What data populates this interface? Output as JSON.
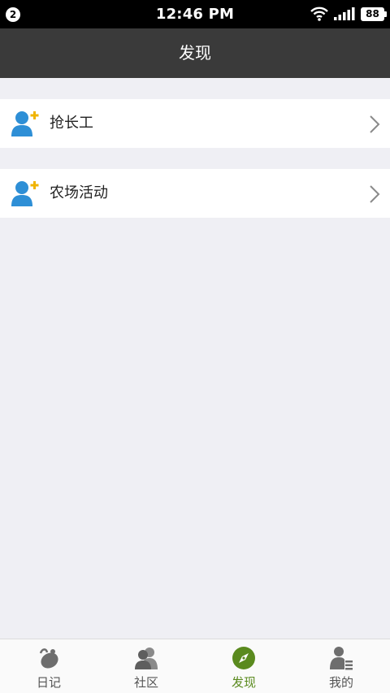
{
  "status_bar": {
    "notification_count": "2",
    "time": "12:46 PM",
    "battery": "88",
    "icons": [
      "wifi-icon",
      "signal-icon",
      "battery-icon"
    ]
  },
  "header": {
    "title": "发现"
  },
  "menu": {
    "items": [
      {
        "label": "抢长工",
        "icon": "add-user-icon"
      },
      {
        "label": "农场活动",
        "icon": "add-user-icon"
      }
    ]
  },
  "tab_bar": {
    "tabs": [
      {
        "label": "日记",
        "icon": "diary-icon"
      },
      {
        "label": "社区",
        "icon": "community-icon"
      },
      {
        "label": "发现",
        "icon": "compass-icon"
      },
      {
        "label": "我的",
        "icon": "profile-icon"
      }
    ],
    "active_index": 2
  },
  "colors": {
    "status_bar_bg": "#000000",
    "title_bar_bg": "#3a3a3a",
    "page_bg": "#efeff4",
    "icon_blue": "#2e8fd6",
    "icon_plus": "#f0b400",
    "active_tab": "#5a8a1e",
    "inactive_tab": "#666666"
  }
}
